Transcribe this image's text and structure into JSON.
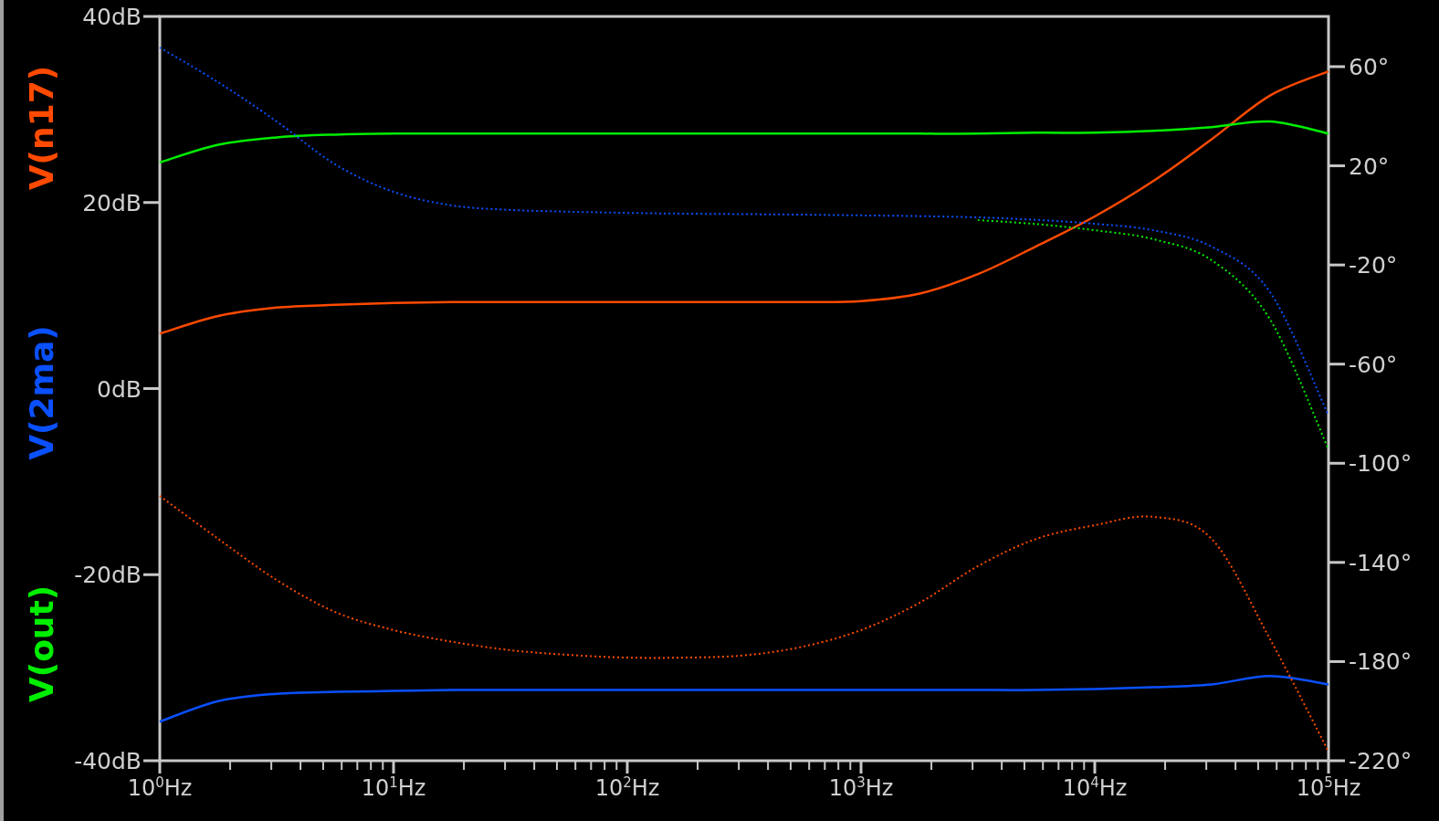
{
  "plot": {
    "chart_data": {
      "type": "line",
      "categories": [
        "10$^{0}$Hz",
        null,
        null,
        null,
        "10$^{1}$Hz",
        null,
        null,
        null,
        "10$^{2}$Hz",
        null,
        null,
        null,
        "10$^{3}$Hz",
        null,
        null,
        null,
        "10$^{4}$Hz",
        null,
        null,
        null,
        "10$^{5}$Hz"
      ],
      "ylim": [
        -40,
        40
      ],
      "y2lim": [
        -220,
        80.26
      ],
      "yticks": [
        {
          "value": 40,
          "label": "40dB"
        },
        {
          "value": 20,
          "label": "20dB"
        },
        {
          "value": 0,
          "label": "0dB"
        },
        {
          "value": -20,
          "label": "-20dB"
        },
        {
          "value": -40,
          "label": "-40dB"
        }
      ],
      "y2ticks": [
        {
          "value": 60,
          "label": "60°"
        },
        {
          "value": 20,
          "label": "20°"
        },
        {
          "value": -20,
          "label": "-20°"
        },
        {
          "value": -60,
          "label": "-60°"
        },
        {
          "value": -100,
          "label": "-100°"
        },
        {
          "value": -140,
          "label": "-140°"
        },
        {
          "value": -180,
          "label": "-180°"
        },
        {
          "value": -220,
          "label": "-220°"
        }
      ],
      "series": [
        {
          "name": "V(n17)",
          "color": "#ff4a00",
          "values": [
            5.9,
            7.8,
            8.7,
            9.0,
            9.2,
            9.3,
            9.3,
            9.3,
            9.3,
            9.3,
            9.3,
            9.3,
            9.4,
            10.2,
            12.3,
            15.3,
            18.5,
            22.3,
            26.8,
            31.5,
            34.1
          ]
        },
        {
          "name": "V(2ma)",
          "color": "#0a50ff",
          "values": [
            -35.8,
            -33.6,
            -32.8,
            -32.6,
            -32.5,
            -32.4,
            -32.4,
            -32.4,
            -32.4,
            -32.4,
            -32.4,
            -32.4,
            -32.4,
            -32.4,
            -32.4,
            -32.4,
            -32.3,
            -32.1,
            -31.8,
            -30.9,
            -31.8
          ]
        },
        {
          "name": "V(out)",
          "color": "#00ee00",
          "values": [
            24.3,
            26.2,
            27.0,
            27.3,
            27.4,
            27.4,
            27.4,
            27.4,
            27.4,
            27.4,
            27.4,
            27.4,
            27.4,
            27.4,
            27.4,
            27.5,
            27.5,
            27.7,
            28.1,
            28.7,
            27.4
          ]
        },
        {
          "color": "#ff4a00",
          "axis": "y2",
          "line_style": "dotted",
          "values": [
            -113.2,
            -130.5,
            -147.1,
            -160,
            -167.3,
            -172,
            -175.4,
            -177.3,
            -178.4,
            -178.4,
            -177.5,
            -174,
            -167.3,
            -156.3,
            -141.5,
            -130.5,
            -125,
            -121.6,
            -130.5,
            -171,
            -216.3
          ]
        },
        {
          "color": "#00ee00",
          "axis": "y2",
          "line_style": "dotted",
          "values": [
            null,
            null,
            null,
            null,
            null,
            null,
            null,
            null,
            null,
            null,
            null,
            null,
            null,
            null,
            -1.9,
            -3.5,
            -6,
            -9.6,
            -18.1,
            -42,
            -94.4
          ]
        },
        {
          "color": "#0a50ff",
          "axis": "y2",
          "line_style": "dotted",
          "values": [
            67.7,
            53.7,
            37.9,
            20.6,
            9.5,
            4,
            2.2,
            1.5,
            1,
            0.7,
            0.5,
            0.3,
            0,
            -0.3,
            -0.8,
            -1.8,
            -3.4,
            -6,
            -12.6,
            -31,
            -80.7
          ]
        }
      ]
    }
  }
}
